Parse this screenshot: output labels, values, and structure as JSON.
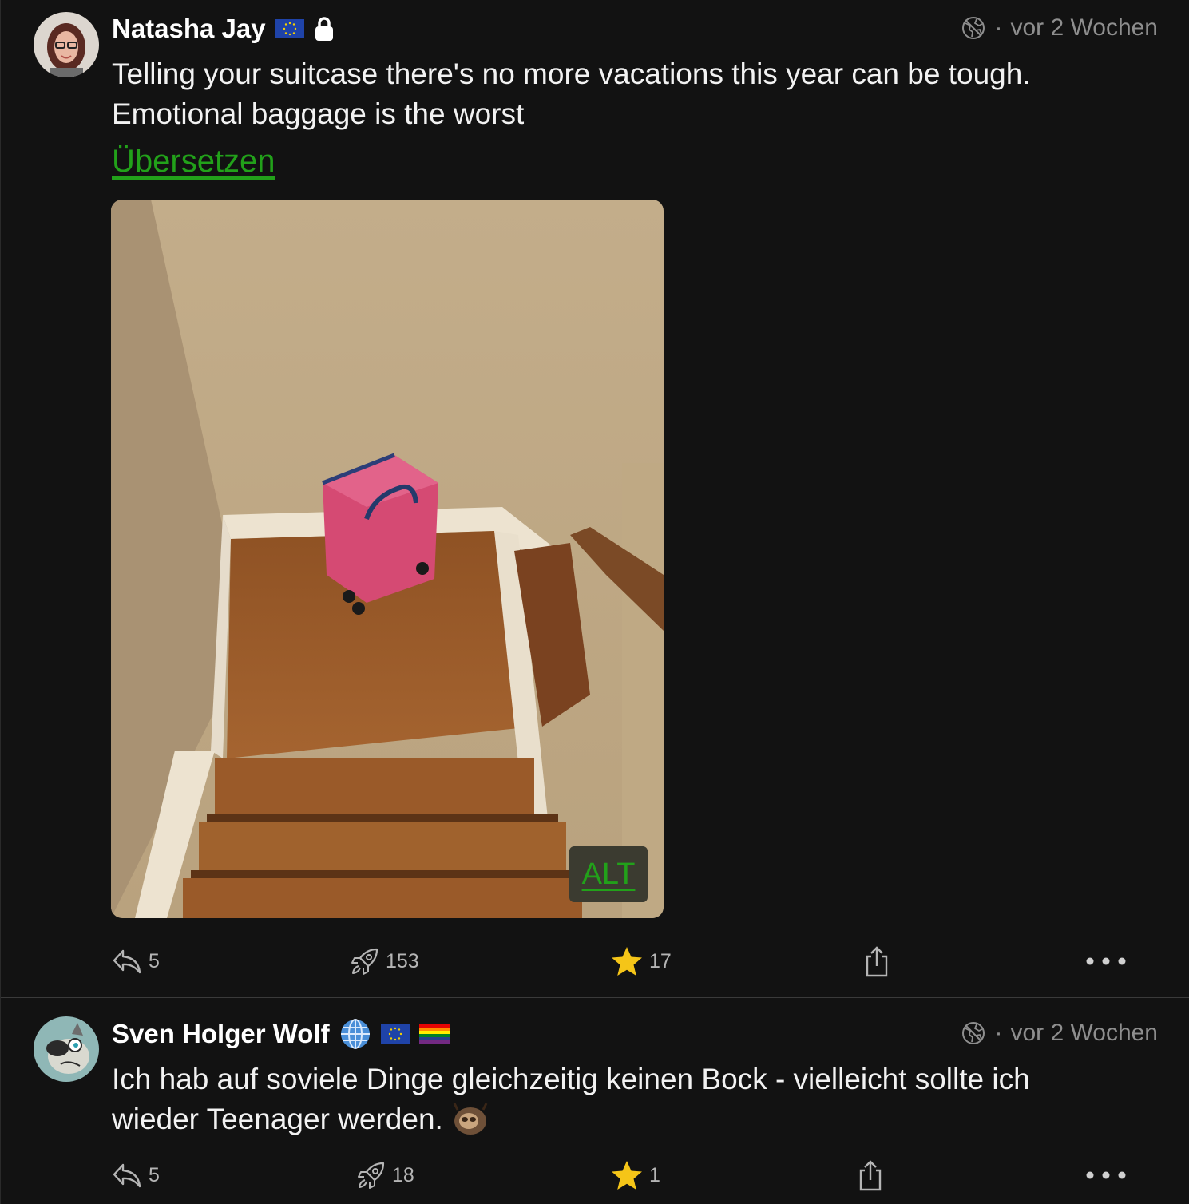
{
  "posts": [
    {
      "author": "Natasha Jay",
      "time": "vor 2 Wochen",
      "separator": "·",
      "content_lines": [
        "Telling your suitcase there's no more vacations this year can be tough.",
        "Emotional baggage is the worst"
      ],
      "translate_label": "Übersetzen",
      "media_alt_label": "ALT",
      "counts": {
        "replies": "5",
        "boosts": "153",
        "favourites": "17"
      },
      "badges": [
        "eu-flag-icon",
        "lock-icon"
      ]
    },
    {
      "author": "Sven Holger Wolf",
      "time": "vor 2 Wochen",
      "separator": "·",
      "content_lines": [
        "Ich hab auf soviele Dinge gleichzeitig keinen Bock - vielleicht sollte ich",
        "wieder Teenager werden."
      ],
      "counts": {
        "replies": "5",
        "boosts": "18",
        "favourites": "1"
      },
      "badges": [
        "globe-emoji-icon",
        "eu-flag-icon",
        "rainbow-flag-icon"
      ]
    }
  ],
  "colors": {
    "background": "#121212",
    "link_green": "#22a11a",
    "star_yellow": "#f5c518",
    "meta_gray": "#8e8e8e"
  }
}
